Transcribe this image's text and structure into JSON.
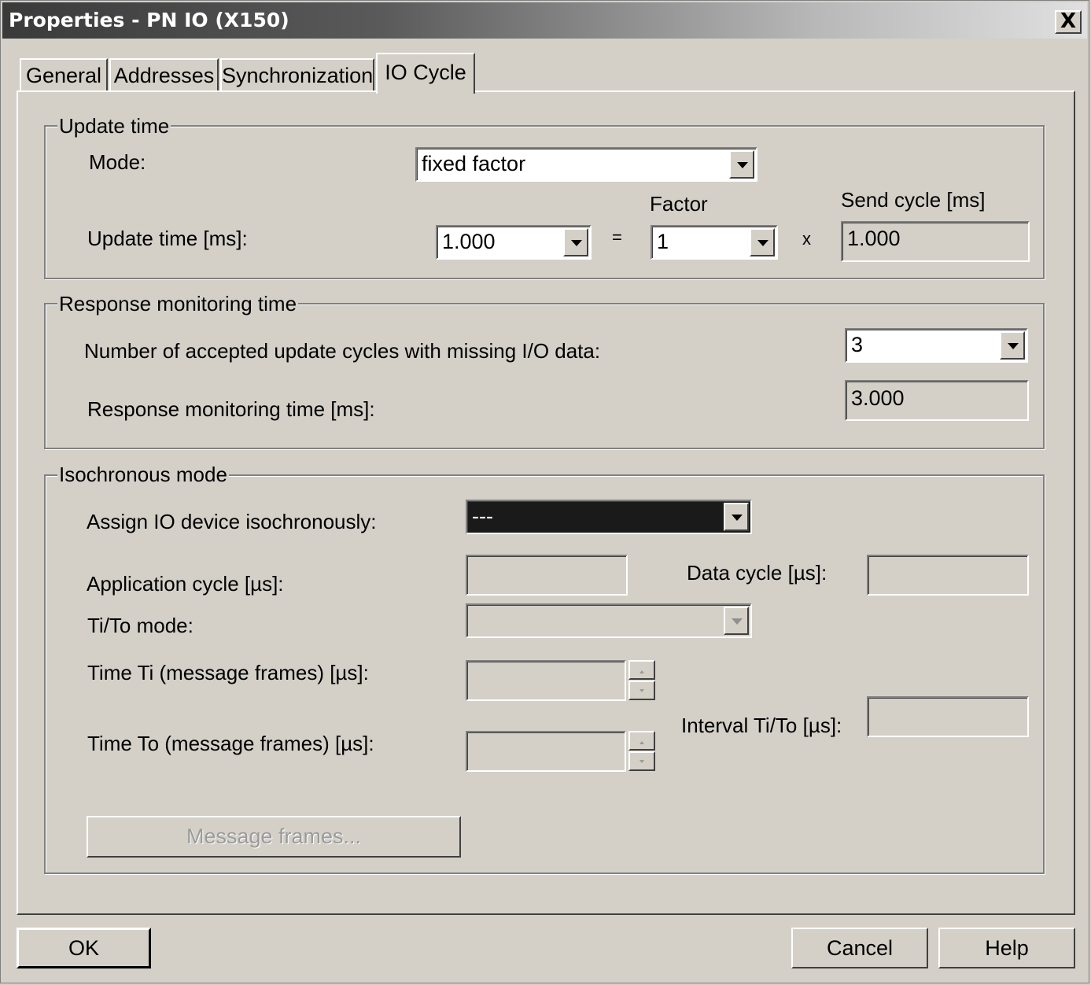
{
  "window": {
    "title": "Properties - PN IO (X150)",
    "close_label": "X"
  },
  "tabs": [
    {
      "label": "General"
    },
    {
      "label": "Addresses"
    },
    {
      "label": "Synchronization"
    },
    {
      "label": "IO Cycle",
      "active": true
    }
  ],
  "update_time": {
    "legend": "Update time",
    "mode_label": "Mode:",
    "mode_value": "fixed factor",
    "update_time_label": "Update time [ms]:",
    "update_time_value": "1.000",
    "equals": "=",
    "factor_header": "Factor",
    "factor_value": "1",
    "times": "x",
    "send_cycle_header": "Send cycle [ms]",
    "send_cycle_value": "1.000"
  },
  "response_monitoring": {
    "legend": "Response monitoring time",
    "accepted_cycles_label": "Number of accepted update cycles with missing I/O data:",
    "accepted_cycles_value": "3",
    "monitoring_time_label": "Response monitoring time [ms]:",
    "monitoring_time_value": "3.000"
  },
  "isochronous": {
    "legend": "Isochronous mode",
    "assign_label": "Assign IO device isochronously:",
    "assign_value": "---",
    "app_cycle_label": "Application cycle [µs]:",
    "app_cycle_value": "",
    "data_cycle_label": "Data cycle [µs]:",
    "data_cycle_value": "",
    "tito_mode_label": "Ti/To mode:",
    "tito_mode_value": "",
    "time_ti_label": "Time Ti (message frames) [µs]:",
    "time_ti_value": "",
    "time_to_label": "Time To (message frames) [µs]:",
    "time_to_value": "",
    "interval_label": "Interval Ti/To [µs]:",
    "interval_value": "",
    "message_frames_button": "Message frames..."
  },
  "footer": {
    "ok": "OK",
    "cancel": "Cancel",
    "help": "Help"
  }
}
